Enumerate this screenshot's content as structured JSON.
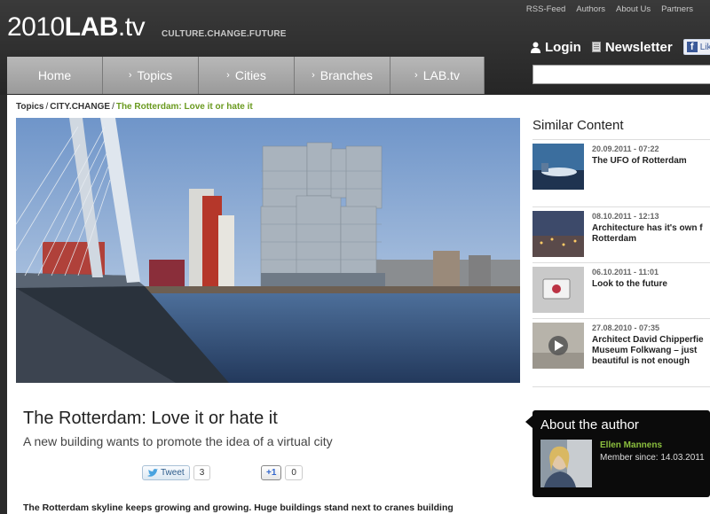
{
  "header": {
    "logo_part1": "2010",
    "logo_part2": "LAB",
    "logo_part3": ".tv",
    "tagline": "CULTURE.CHANGE.FUTURE",
    "top_links": [
      "RSS-Feed",
      "Authors",
      "About Us",
      "Partners"
    ],
    "login_label": "Login",
    "newsletter_label": "Newsletter",
    "like_label": "Like",
    "search_placeholder": ""
  },
  "nav": {
    "home": "Home",
    "topics": "Topics",
    "cities": "Cities",
    "branches": "Branches",
    "labtv": "LAB.tv"
  },
  "breadcrumb": {
    "topics": "Topics",
    "section": "CITY.CHANGE",
    "current": "The Rotterdam: Love it or hate it"
  },
  "article": {
    "title": "The Rotterdam: Love it or hate it",
    "subtitle": "A new building wants to promote the idea of a virtual city",
    "tweet_label": "Tweet",
    "tweet_count": "3",
    "plusone_label": "+1",
    "plusone_count": "0",
    "body_start": "The Rotterdam skyline keeps growing and growing. Huge buildings stand next to cranes building"
  },
  "sidebar": {
    "similar_heading": "Similar Content",
    "items": [
      {
        "date": "20.09.2011 - 07:22",
        "title": "The UFO of Rotterdam"
      },
      {
        "date": "08.10.2011 - 12:13",
        "title": "Architecture has it's own f\nRotterdam"
      },
      {
        "date": "06.10.2011 - 11:01",
        "title": "Look to the future"
      },
      {
        "date": "27.08.2010 - 07:35",
        "title": "Architect David Chipperfie\nMuseum Folkwang – just\nbeautiful is not enough"
      }
    ],
    "about_heading": "About the author",
    "author_name": "Ellen Mannens",
    "member_since": "Member since: 14.03.2011"
  },
  "colors": {
    "accent_green": "#6a9a1f",
    "author_green": "#8bbf3e",
    "header_bg": "#2b2b2b",
    "nav_tab": "#a8a8a8"
  }
}
